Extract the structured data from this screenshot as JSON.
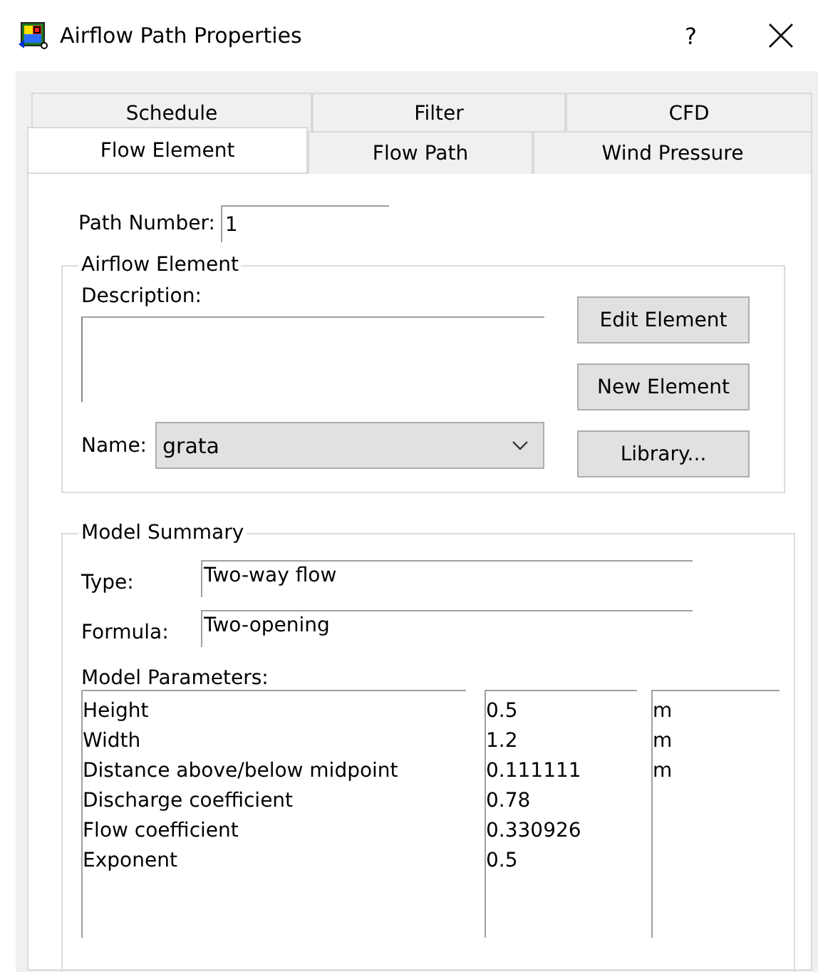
{
  "window": {
    "title": "Airflow Path Properties",
    "help": "?"
  },
  "tab_rows": [
    {
      "tabs": [
        {
          "label": "Schedule",
          "selected": false
        },
        {
          "label": "Filter",
          "selected": false
        },
        {
          "label": "CFD",
          "selected": false
        }
      ]
    },
    {
      "tabs": [
        {
          "label": "Flow Element",
          "selected": true
        },
        {
          "label": "Flow Path",
          "selected": false
        },
        {
          "label": "Wind Pressure",
          "selected": false
        }
      ]
    }
  ],
  "path_number": {
    "label": "Path Number:",
    "value": "1"
  },
  "airflow_element": {
    "title": "Airflow Element",
    "description_label": "Description:",
    "name_label": "Name:",
    "name_value": "grata",
    "buttons": [
      "Edit Element",
      "New Element",
      "Library..."
    ]
  },
  "model_summary": {
    "title": "Model Summary",
    "type_label": "Type:",
    "type_value": "Two-way flow",
    "formula_label": "Formula:",
    "formula_value": "Two-opening",
    "parameters_label": "Model Parameters:",
    "parameters": [
      {
        "name": "Height",
        "value": "0.5",
        "unit": "m"
      },
      {
        "name": "Width",
        "value": "1.2",
        "unit": "m"
      },
      {
        "name": "Distance above/below midpoint",
        "value": "0.111111",
        "unit": "m"
      },
      {
        "name": "Discharge coefficient",
        "value": "0.78"
      },
      {
        "name": "Flow coefficient",
        "value": "0.330926"
      },
      {
        "name": "Exponent",
        "value": "0.5"
      }
    ]
  }
}
